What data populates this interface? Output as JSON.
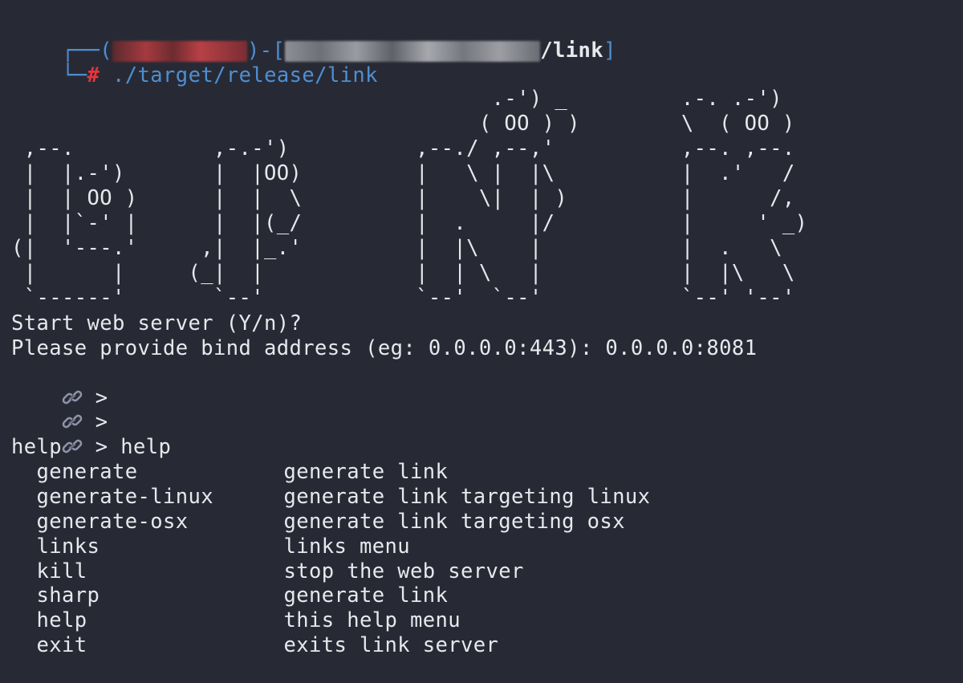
{
  "prompt": {
    "box_open": "┌──(",
    "mid": ")-[",
    "path_visible": "/link",
    "box_close": "]",
    "corner": "└─",
    "hash": "#",
    "command": " ./target/release/link"
  },
  "banner": {
    "art": "                                      .-') _         .-. .-')\n                                     ( OO ) )        \\  ( OO )\n ,--.           ,-.-')          ,--./ ,--,'          ,--. ,--.\n |  |.-')       |  |OO)         |   \\ |  |\\          |  .'   /\n |  | OO )      |  |  \\         |    \\|  | )         |      /,\n |  |`-' |      |  |(_/         |  .     |/          |     ' _)\n(|  '---.'     ,|  |_.'         |  |\\    |           |  .   \\\n |      |     (_|  |            |  | \\   |           |  |\\   \\\n `------'       `--'            `--'  `--'           `--' '--'"
  },
  "prompts": {
    "start_server": "Start web server (Y/n)?",
    "bind_address": "Please provide bind address (eg: 0.0.0.0:443): 0.0.0.0:8081"
  },
  "shell": {
    "prompt_symbol": " > ",
    "history": [
      "",
      "",
      "help"
    ],
    "echo": "help"
  },
  "help_menu": [
    {
      "command": "generate",
      "description": "generate link"
    },
    {
      "command": "generate-linux",
      "description": "generate link targeting linux"
    },
    {
      "command": "generate-osx",
      "description": "generate link targeting osx"
    },
    {
      "command": "links",
      "description": "links menu"
    },
    {
      "command": "kill",
      "description": "stop the web server"
    },
    {
      "command": "sharp",
      "description": "generate link"
    },
    {
      "command": "help",
      "description": "this help menu"
    },
    {
      "command": "exit",
      "description": "exits link server"
    }
  ],
  "icons": {
    "prompt_icon": "link-icon"
  },
  "colors": {
    "background": "#272a35",
    "text": "#e8e8ec",
    "prompt_blue": "#4e8fd2",
    "prompt_red": "#e8343b",
    "redaction_user": "#a53a3f",
    "redaction_path": "#8d8f96"
  }
}
